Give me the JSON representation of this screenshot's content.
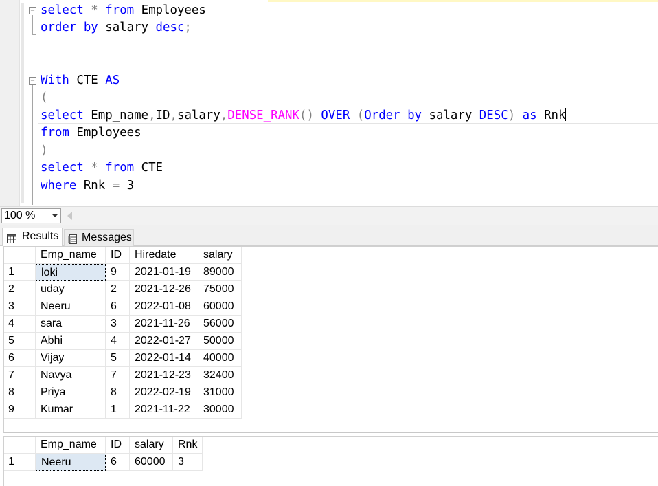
{
  "editor": {
    "lines": {
      "l1": {
        "kw1": "select",
        "op1": " *",
        "kw2": " from",
        "id1": " Employees"
      },
      "l2": {
        "kw1": "order by",
        "id1": " salary",
        "kw2": " desc",
        "op1": ";"
      },
      "l5": {
        "kw1": "With",
        "id1": " CTE",
        "kw2": " AS"
      },
      "l6": {
        "op1": "("
      },
      "l7": {
        "kw1": "select",
        "id1": " Emp_name",
        "op1": ",",
        "id2": "ID",
        "op2": ",",
        "id3": "salary",
        "op3": ",",
        "fn1": "DENSE_RANK",
        "op4": "()",
        "kw2": " OVER",
        "op5": " (",
        "kw3": "Order by",
        "id4": " salary",
        "kw4": " DESC",
        "op6": ")",
        "kw5": " as",
        "id5": " Rnk"
      },
      "l8": {
        "kw1": "from",
        "id1": " Employees"
      },
      "l9": {
        "op1": ")"
      },
      "l10": {
        "kw1": "select",
        "op1": " *",
        "kw2": " from",
        "id1": " CTE"
      },
      "l11": {
        "kw1": "where",
        "id1": " Rnk",
        "op1": " =",
        "num1": " 3"
      }
    },
    "fold_symbol": "−"
  },
  "zoom": {
    "value": "100 %"
  },
  "tabs": {
    "results_label": "Results",
    "messages_label": "Messages"
  },
  "grid1": {
    "columns": [
      "Emp_name",
      "ID",
      "Hiredate",
      "salary"
    ],
    "rows": [
      {
        "n": "1",
        "cells": [
          "loki",
          "9",
          "2021-01-19",
          "89000"
        ]
      },
      {
        "n": "2",
        "cells": [
          "uday",
          "2",
          "2021-12-26",
          "75000"
        ]
      },
      {
        "n": "3",
        "cells": [
          "Neeru",
          "6",
          "2022-01-08",
          "60000"
        ]
      },
      {
        "n": "4",
        "cells": [
          "sara",
          "3",
          "2021-11-26",
          "56000"
        ]
      },
      {
        "n": "5",
        "cells": [
          "Abhi",
          "4",
          "2022-01-27",
          "50000"
        ]
      },
      {
        "n": "6",
        "cells": [
          "Vijay",
          "5",
          "2022-01-14",
          "40000"
        ]
      },
      {
        "n": "7",
        "cells": [
          "Navya",
          "7",
          "2021-12-23",
          "32400"
        ]
      },
      {
        "n": "8",
        "cells": [
          "Priya",
          "8",
          "2022-02-19",
          "31000"
        ]
      },
      {
        "n": "9",
        "cells": [
          "Kumar",
          "1",
          "2021-11-22",
          "30000"
        ]
      }
    ]
  },
  "grid2": {
    "columns": [
      "Emp_name",
      "ID",
      "salary",
      "Rnk"
    ],
    "rows": [
      {
        "n": "1",
        "cells": [
          "Neeru",
          "6",
          "60000",
          "3"
        ]
      }
    ]
  }
}
